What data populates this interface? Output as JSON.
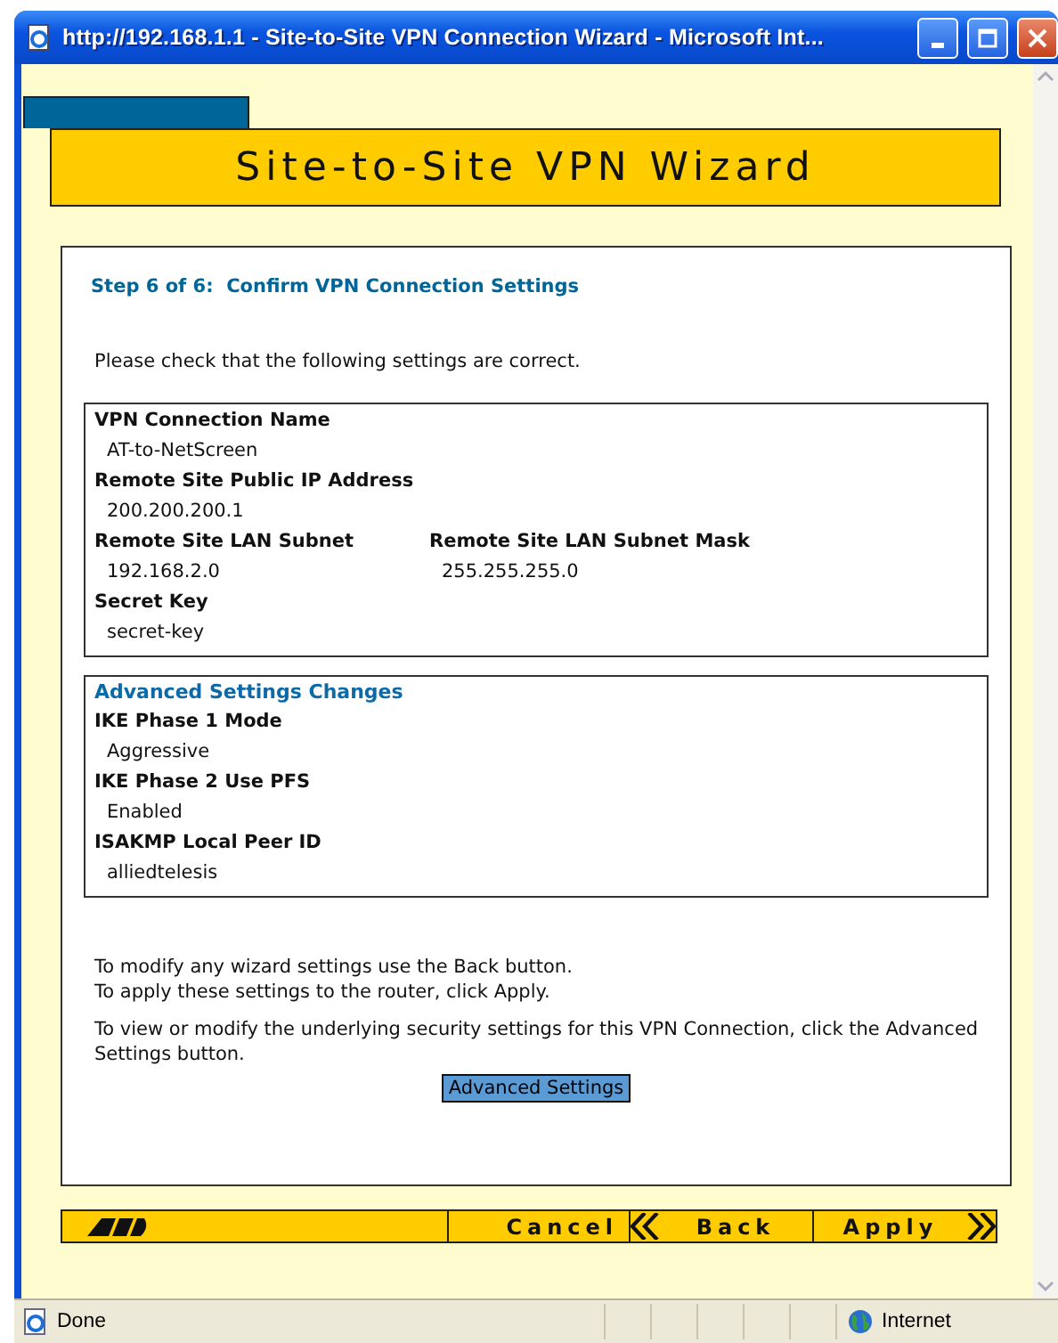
{
  "window": {
    "title": "http://192.168.1.1 - Site-to-Site VPN Connection Wizard - Microsoft Int..."
  },
  "banner": {
    "title": "Site-to-Site VPN Wizard"
  },
  "step_title": "Step 6 of 6:  Confirm VPN Connection Settings",
  "intro": "Please check that the following settings are correct.",
  "settings": {
    "rows": [
      {
        "fields": [
          {
            "label": "VPN Connection Name",
            "value": "AT-to-NetScreen"
          }
        ]
      },
      {
        "fields": [
          {
            "label": "Remote Site Public IP Address",
            "value": "200.200.200.1"
          }
        ]
      },
      {
        "fields": [
          {
            "label": "Remote Site LAN Subnet",
            "value": "192.168.2.0"
          },
          {
            "label": "Remote Site LAN Subnet Mask",
            "value": "255.255.255.0"
          }
        ]
      },
      {
        "fields": [
          {
            "label": "Secret Key",
            "value": "secret-key"
          }
        ]
      }
    ]
  },
  "advanced": {
    "heading": "Advanced Settings Changes",
    "fields": [
      {
        "label": "IKE Phase 1 Mode",
        "value": "Aggressive"
      },
      {
        "label": "IKE Phase 2 Use PFS",
        "value": "Enabled"
      },
      {
        "label": "ISAKMP Local Peer ID",
        "value": "alliedtelesis"
      }
    ]
  },
  "notes": [
    "To modify any wizard settings use the Back button.",
    "To apply these settings to the router, click Apply."
  ],
  "advanced_note": "To view or modify the underlying security settings for this VPN Connection, click the Advanced Settings button.",
  "advanced_button": "Advanced Settings",
  "footer": {
    "buttons": [
      {
        "label": "Cancel",
        "kind": "plain"
      },
      {
        "label": "Back",
        "kind": "back"
      },
      {
        "label": "Apply",
        "kind": "next"
      }
    ]
  },
  "status_bar": {
    "text": "Done",
    "zone": "Internet"
  }
}
